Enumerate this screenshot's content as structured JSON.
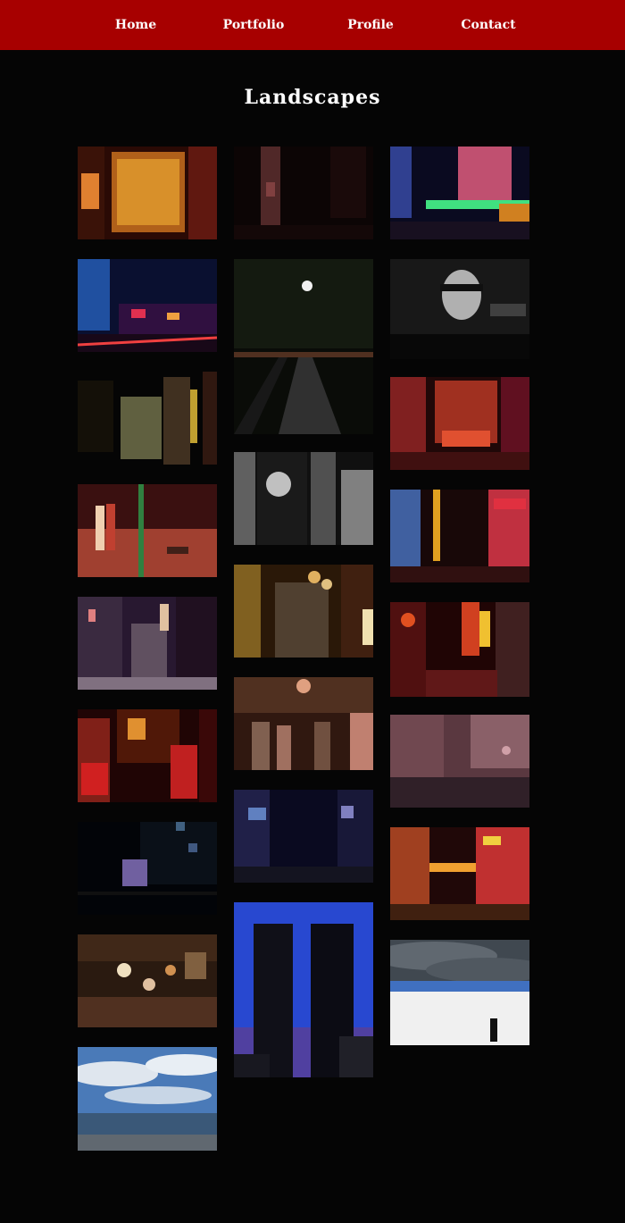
{
  "nav": {
    "items": [
      {
        "label": "Home"
      },
      {
        "label": "Portfolio"
      },
      {
        "label": "Profile"
      },
      {
        "label": "Contact"
      }
    ],
    "bg_color": "#a70000"
  },
  "page": {
    "title": "Landscapes",
    "bg_color": "#050505"
  },
  "gallery": {
    "columns": [
      {
        "photos": [
          {
            "name": "photo-bar-doorway-stickers",
            "sky": "#2a0a05",
            "accent": "#e0801a"
          },
          {
            "name": "photo-city-street-night",
            "sky": "#0a1030",
            "accent": "#e03050"
          },
          {
            "name": "photo-dark-alley-graffiti",
            "sky": "#050505",
            "accent": "#c0a030"
          },
          {
            "name": "photo-crosswalk-people",
            "sky": "#200808",
            "accent": "#c04030"
          },
          {
            "name": "photo-alley-lanterns-purple",
            "sky": "#281830",
            "accent": "#e0c0a0"
          },
          {
            "name": "photo-bar-storefront-red",
            "sky": "#200505",
            "accent": "#d02020"
          },
          {
            "name": "photo-dark-building-lights",
            "sky": "#020408",
            "accent": "#7070a0"
          },
          {
            "name": "photo-izakaya-signs",
            "sky": "#2a1a10",
            "accent": "#d09050"
          },
          {
            "name": "photo-sea-clouds",
            "sky": "#4a7ab8",
            "accent": "#dfe6ee"
          }
        ]
      },
      {
        "photos": [
          {
            "name": "photo-dark-pole-street",
            "sky": "#0c0505",
            "accent": "#804040"
          },
          {
            "name": "photo-night-path-trees",
            "sky": "#0a0c08",
            "accent": "#d0d0d0"
          },
          {
            "name": "photo-joker-graffiti-bw",
            "sky": "#101010",
            "accent": "#c0c0c0"
          },
          {
            "name": "photo-narrow-alley-lanterns",
            "sky": "#2a1808",
            "accent": "#e0b060"
          },
          {
            "name": "photo-crowded-alley-sepia",
            "sky": "#301810",
            "accent": "#e0a080"
          },
          {
            "name": "photo-blue-alley-night",
            "sky": "#0a0a20",
            "accent": "#8080c0"
          },
          {
            "name": "photo-towers-blue-sky",
            "sky": "#2848d0",
            "accent": "#101018"
          }
        ]
      },
      {
        "photos": [
          {
            "name": "photo-tower-bridge-green",
            "sky": "#0a0a20",
            "accent": "#40e080"
          },
          {
            "name": "photo-billboard-woman",
            "sky": "#080808",
            "accent": "#b0b0b0"
          },
          {
            "name": "photo-neon-intersection",
            "sky": "#200808",
            "accent": "#e05030"
          },
          {
            "name": "photo-neon-signs-street",
            "sky": "#180808",
            "accent": "#e03040"
          },
          {
            "name": "photo-red-lanterns-alley",
            "sky": "#200505",
            "accent": "#e05020"
          },
          {
            "name": "photo-pink-street-faded",
            "sky": "#5a3840",
            "accent": "#d0a0a8"
          },
          {
            "name": "photo-kabukicho-gate",
            "sky": "#200808",
            "accent": "#f0a030"
          },
          {
            "name": "photo-stormy-plaza-figure",
            "sky": "#404850",
            "accent": "#f0f0f0"
          }
        ]
      }
    ]
  }
}
